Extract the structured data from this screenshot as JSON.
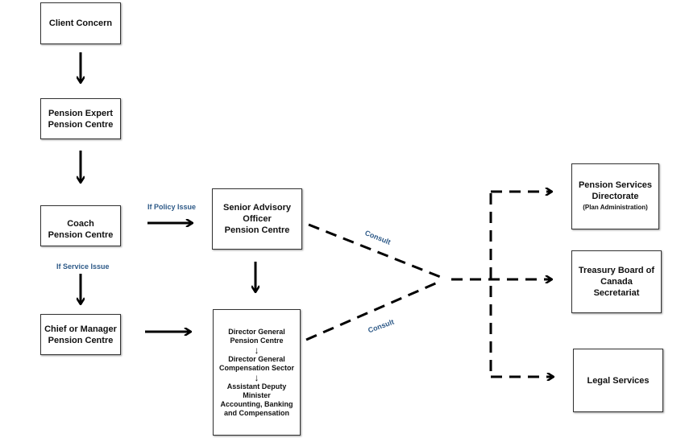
{
  "nodes": {
    "client_concern": [
      "Client Concern"
    ],
    "pension_expert": [
      "Pension Expert",
      "Pension Centre"
    ],
    "coach": [
      "Coach",
      "Pension Centre"
    ],
    "chief": [
      "Chief or Manager",
      "Pension Centre"
    ],
    "senior_advisory": [
      "Senior Advisory",
      "Officer",
      "Pension Centre"
    ],
    "director_stack": {
      "dg_pension": [
        "Director General",
        "Pension Centre"
      ],
      "dg_compensation": [
        "Director General",
        "Compensation Sector"
      ],
      "adm": [
        "Assistant Deputy",
        "Minister",
        "Accounting, Banking",
        "and Compensation"
      ]
    },
    "pension_services": [
      "Pension Services",
      "Directorate",
      "(Plan Administration)"
    ],
    "treasury_board": [
      "Treasury Board of",
      "Canada",
      "Secretariat"
    ],
    "legal_services": [
      "Legal Services"
    ]
  },
  "edge_labels": {
    "policy": "If Policy Issue",
    "service": "If Service Issue",
    "consult_top": "Consult",
    "consult_bottom": "Consult"
  },
  "colors": {
    "label": "#2e5a88",
    "line": "#000000"
  }
}
